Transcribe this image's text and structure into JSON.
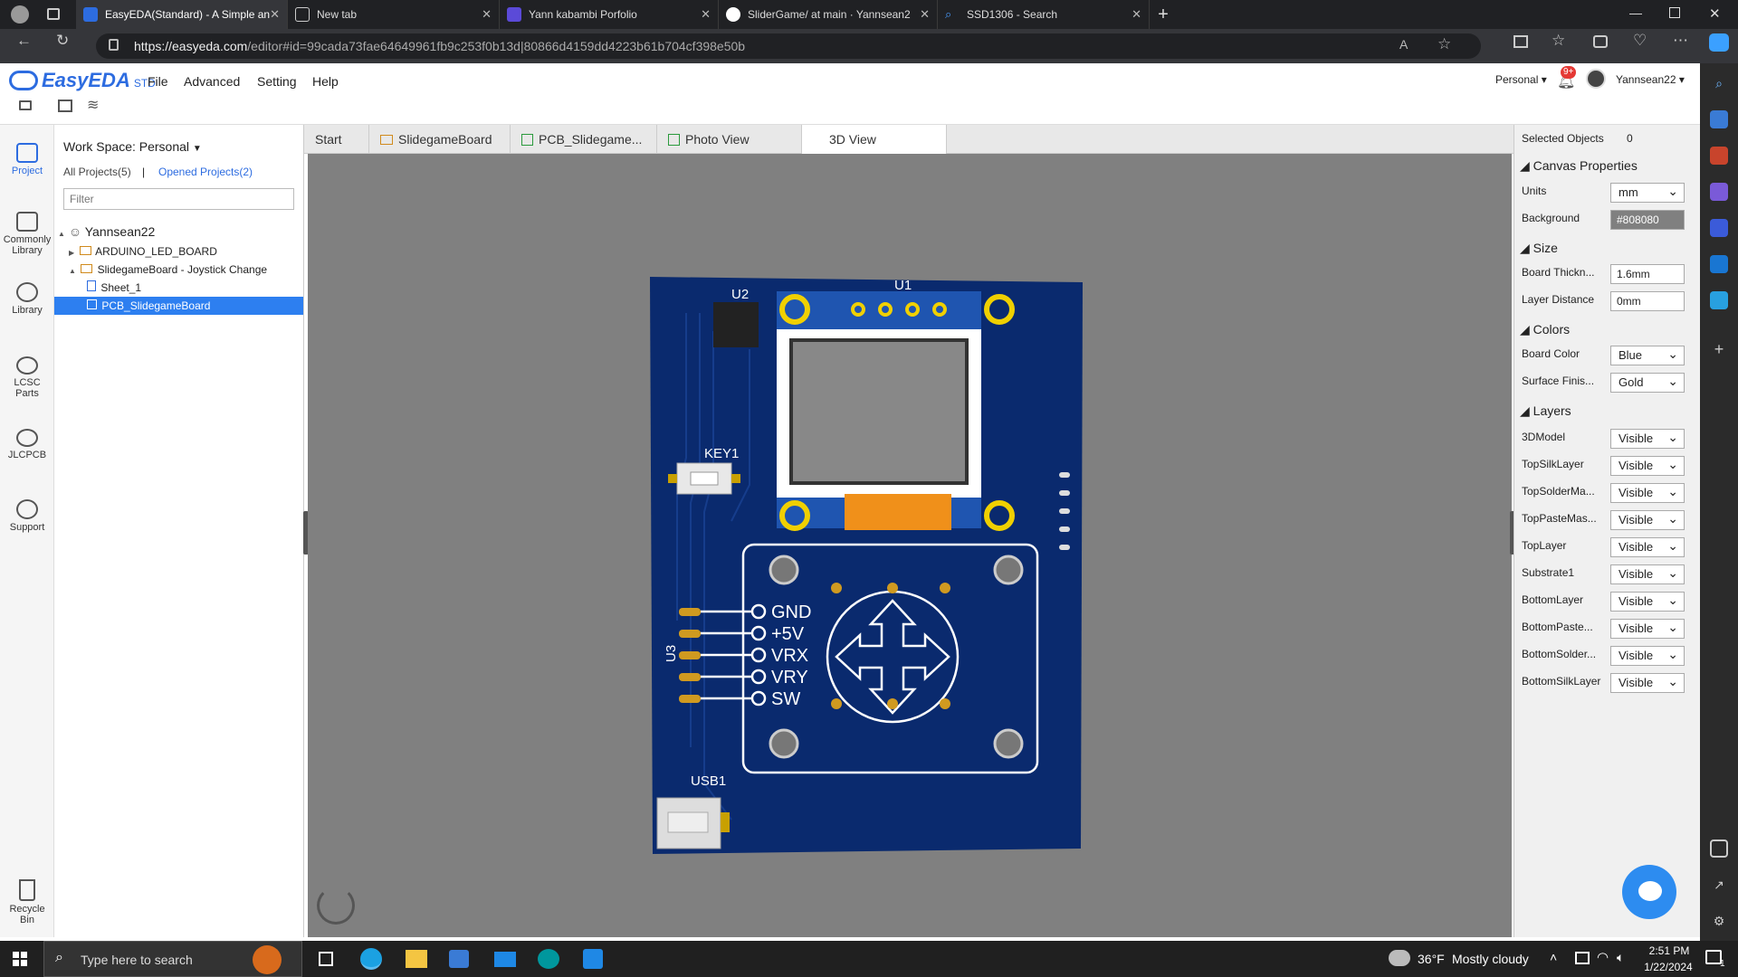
{
  "browser": {
    "tabs": [
      {
        "title": "EasyEDA(Standard) - A Simple an",
        "active": true,
        "favicon": "easyeda-icon"
      },
      {
        "title": "New tab",
        "active": false,
        "favicon": "newtab-icon"
      },
      {
        "title": "Yann kabambi Porfolio",
        "active": false,
        "favicon": "portfolio-icon"
      },
      {
        "title": "SliderGame/ at main · Yannsean2",
        "active": false,
        "favicon": "github-icon"
      },
      {
        "title": "SSD1306 - Search",
        "active": false,
        "favicon": "search-icon"
      }
    ],
    "url_host": "https://easyeda.com",
    "url_path": "/editor#id=99cada73fae64649961fb9c253f0b13d|80866d4159dd4223b61b704cf398e50b"
  },
  "app": {
    "logo": "EasyEDA",
    "logo_std": "STD",
    "menu": [
      "File",
      "Advanced",
      "Setting",
      "Help"
    ],
    "account_type": "Personal",
    "notif_badge": "9+",
    "username": "Yannsean22",
    "accent": "#2d6ce0"
  },
  "left_bar": [
    {
      "label": "Project",
      "icon": "project-icon"
    },
    {
      "label": "Commonly Library",
      "icon": "chip-icon"
    },
    {
      "label": "Library",
      "icon": "search-library-icon"
    },
    {
      "label": "LCSC Parts",
      "icon": "lcsc-icon"
    },
    {
      "label": "JLCPCB",
      "icon": "jlcpcb-icon"
    },
    {
      "label": "Support",
      "icon": "support-icon"
    },
    {
      "label": "Recycle Bin",
      "icon": "trash-icon"
    }
  ],
  "project_panel": {
    "workspace": "Work Space: Personal",
    "all_projects": "All Projects(5)",
    "separator": "|",
    "opened_projects": "Opened Projects(2)",
    "filter_placeholder": "Filter",
    "tree": {
      "user": "Yannsean22",
      "project1": "ARDUINO_LED_BOARD",
      "project2": "SlidegameBoard - Joystick Change",
      "sheet": "Sheet_1",
      "pcb": "PCB_SlidegameBoard"
    }
  },
  "doc_tabs": [
    "Start",
    "SlidegameBoard",
    "PCB_Slidegame...",
    "Photo View",
    "3D View"
  ],
  "pcb_labels": {
    "u2": "U2",
    "u1": "U1",
    "key1": "KEY1",
    "u3": "U3",
    "usb1": "USB1",
    "pins": [
      "GND",
      "+5V",
      "VRX",
      "VRY",
      "SW"
    ],
    "board_color": "#0a2a6e"
  },
  "right_panel": {
    "selected_label": "Selected Objects",
    "selected_count": "0",
    "canvas_title": "Canvas Properties",
    "units_label": "Units",
    "units_value": "mm",
    "background_label": "Background",
    "background_value": "#808080",
    "size_title": "Size",
    "thick_label": "Board Thickn...",
    "thick_value": "1.6mm",
    "layerdist_label": "Layer Distance",
    "layerdist_value": "0mm",
    "colors_title": "Colors",
    "boardcolor_label": "Board Color",
    "boardcolor_value": "Blue",
    "finish_label": "Surface Finis...",
    "finish_value": "Gold",
    "layers_title": "Layers",
    "layers": [
      {
        "name": "3DModel",
        "value": "Visible"
      },
      {
        "name": "TopSilkLayer",
        "value": "Visible"
      },
      {
        "name": "TopSolderMa...",
        "value": "Visible"
      },
      {
        "name": "TopPasteMas...",
        "value": "Visible"
      },
      {
        "name": "TopLayer",
        "value": "Visible"
      },
      {
        "name": "Substrate1",
        "value": "Visible"
      },
      {
        "name": "BottomLayer",
        "value": "Visible"
      },
      {
        "name": "BottomPaste...",
        "value": "Visible"
      },
      {
        "name": "BottomSolder...",
        "value": "Visible"
      },
      {
        "name": "BottomSilkLayer",
        "value": "Visible"
      }
    ]
  },
  "taskbar": {
    "search_placeholder": "Type here to search",
    "weather_temp": "36°F",
    "weather_desc": "Mostly cloudy",
    "time": "2:51 PM",
    "date": "1/22/2024",
    "notif_count": "1"
  }
}
